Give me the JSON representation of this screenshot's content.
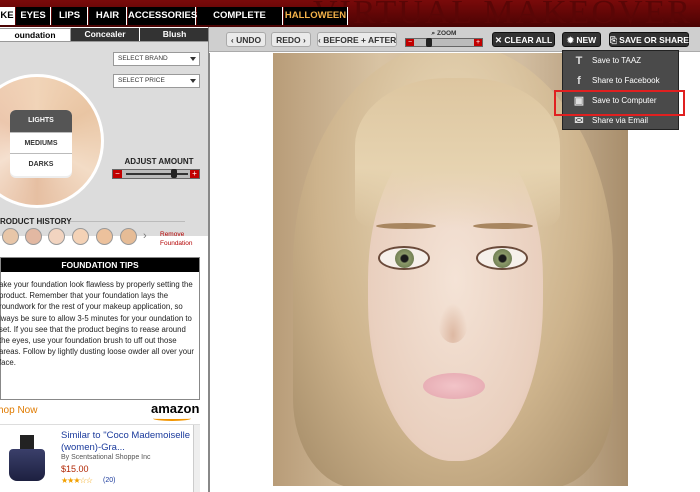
{
  "brand": "VIRTUAL MAKEOVER",
  "nav": {
    "tabs": [
      {
        "label": "KE"
      },
      {
        "label": "EYES"
      },
      {
        "label": "LIPS"
      },
      {
        "label": "HAIR"
      },
      {
        "label": "ACCESSORIES"
      },
      {
        "label": "COMPLETE LOOKS"
      },
      {
        "label": "HALLOWEEN"
      }
    ]
  },
  "subtabs": [
    {
      "label": "oundation"
    },
    {
      "label": "Concealer"
    },
    {
      "label": "Blush"
    }
  ],
  "filters": {
    "brand": "SELECT BRAND",
    "price": "SELECT PRICE"
  },
  "shades": {
    "lights": "LIGHTS",
    "mediums": "MEDIUMS",
    "darks": "DARKS"
  },
  "adjust": {
    "label": "ADJUST AMOUNT",
    "minus": "−",
    "plus": "+"
  },
  "history": {
    "label": "RODUCT HISTORY",
    "remove": "Remove Foundation",
    "swatches": [
      "#e8c6a8",
      "#e2b8a2",
      "#f2d4c0",
      "#f4d2b6",
      "#ecc19c",
      "#e6bc96",
      "#d9a87e"
    ]
  },
  "tips": {
    "title": "FOUNDATION TIPS",
    "body": "ake your foundation look flawless by properly setting the product. Remember that your foundation lays the roundwork for the rest of your makeup application, so lways be sure to allow 3-5 minutes for your oundation to set. If you see that the product begins to rease around the eyes, use your foundation brush to uff out those areas. Follow by lightly dusting loose owder all over your face."
  },
  "ad": {
    "shop_now": "hop Now",
    "amazon": "amazon",
    "title": "Similar to \"Coco Mademoiselle (women)-Gra...",
    "seller": "By Scentsational Shoppe Inc",
    "price": "$15.00",
    "stars": "★★★☆☆",
    "reviews": "(20)"
  },
  "toolbar": {
    "undo": "UNDO",
    "redo": "REDO",
    "before_after": "BEFORE + AFTER",
    "zoom": "ZOOM",
    "clear_all": "CLEAR ALL",
    "new": "NEW",
    "save_share": "SAVE OR SHARE"
  },
  "share_menu": [
    {
      "label": "Save to TAAZ",
      "icon": "T"
    },
    {
      "label": "Share to Facebook",
      "icon": "f"
    },
    {
      "label": "Save to Computer",
      "icon": "▣"
    },
    {
      "label": "Share via Email",
      "icon": "✉"
    }
  ]
}
